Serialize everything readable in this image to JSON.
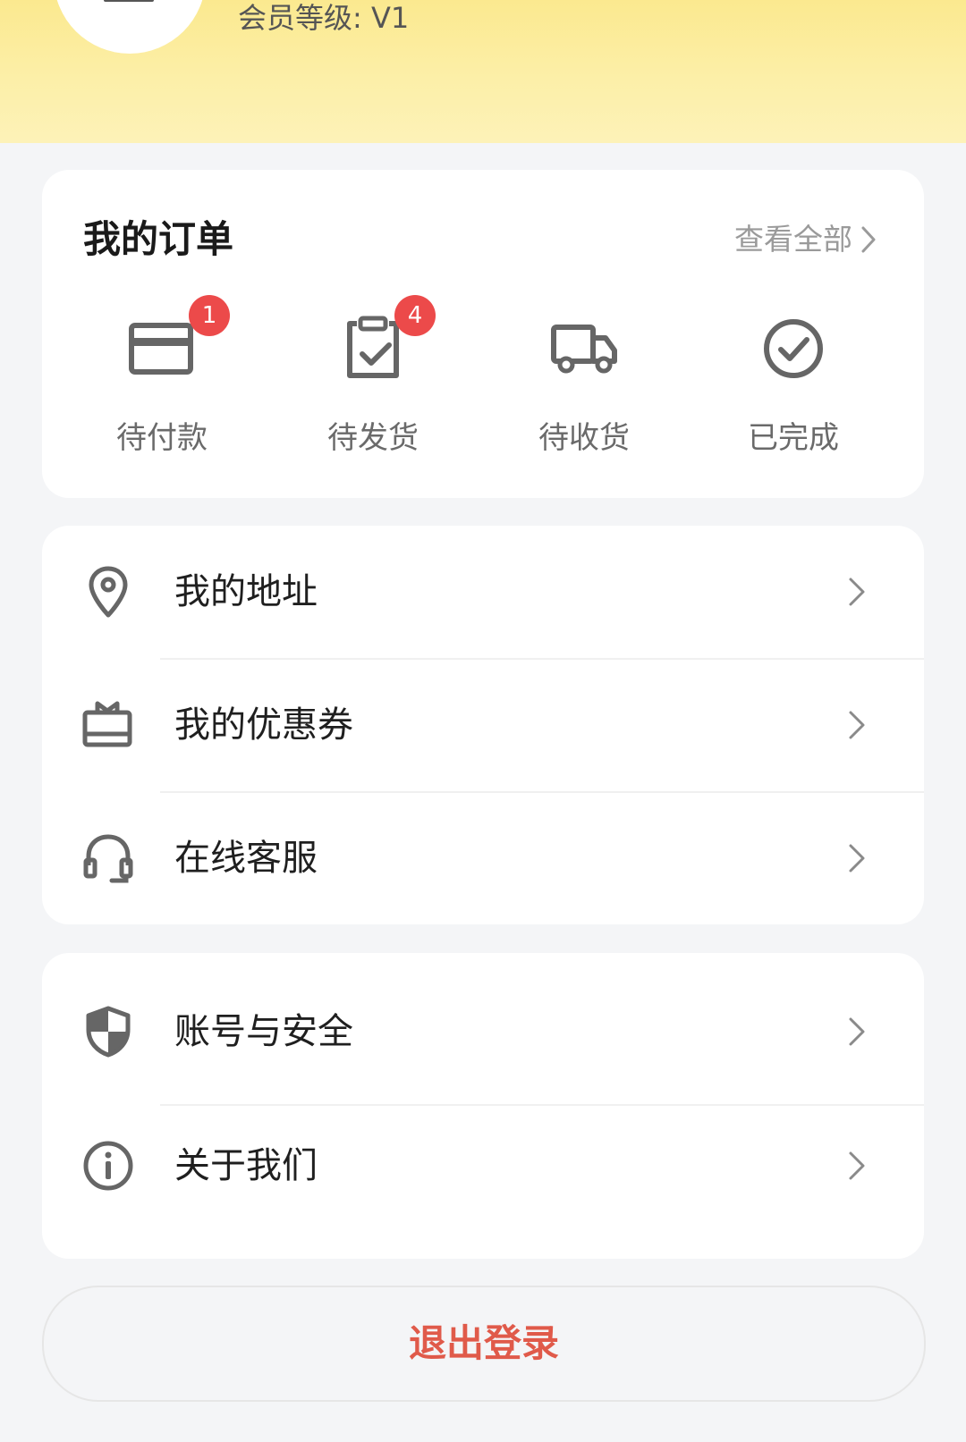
{
  "header": {
    "member_level": "会员等级: V1",
    "background_color": "#fcefa8"
  },
  "orders": {
    "title": "我的订单",
    "view_all_label": "查看全部",
    "items": [
      {
        "label": "待付款",
        "icon": "card-icon",
        "badge": "1"
      },
      {
        "label": "待发货",
        "icon": "clipboard-check-icon",
        "badge": "4"
      },
      {
        "label": "待收货",
        "icon": "truck-icon",
        "badge": ""
      },
      {
        "label": "已完成",
        "icon": "check-circle-icon",
        "badge": ""
      }
    ],
    "badge_color": "#ec4a4a"
  },
  "menu_group_1": [
    {
      "label": "我的地址",
      "icon": "location-pin-icon"
    },
    {
      "label": "我的优惠券",
      "icon": "coupon-icon"
    },
    {
      "label": "在线客服",
      "icon": "headset-icon"
    }
  ],
  "menu_group_2": [
    {
      "label": "账号与安全",
      "icon": "shield-icon"
    },
    {
      "label": "关于我们",
      "icon": "info-icon"
    }
  ],
  "logout": {
    "label": "退出登录",
    "color": "#e05a4a"
  }
}
